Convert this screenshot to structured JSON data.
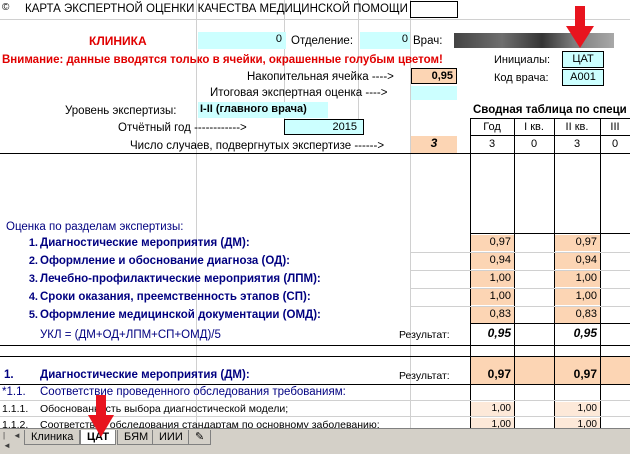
{
  "header": {
    "icon_label": "©",
    "title": "КАРТА ЭКСПЕРТНОЙ ОЦЕНКИ КАЧЕСТВА МЕДИЦИНСКОЙ ПОМОЩИ",
    "clinic_label": "КЛИНИКА",
    "clinic_value": "0",
    "department_label": "Отделение:",
    "department_value": "0",
    "doctor_label": "Врач:"
  },
  "warning": "Внимание: данные вводятся только в ячейки, окрашенные голубым цветом!",
  "initials": {
    "label": "Инициалы:",
    "value": "ЦАТ"
  },
  "doctor_code": {
    "label": "Код врача:",
    "value": "А001"
  },
  "accumulating_cell": {
    "label": "Накопительная ячейка ---->",
    "value": "0,95"
  },
  "final_score": {
    "label": "Итоговая экспертная оценка ---->",
    "value": ""
  },
  "expertise_level": {
    "label": "Уровень экспертизы:",
    "value": "I-II (главного врача)"
  },
  "report_year": {
    "label": "Отчётный год ------------>",
    "value": "2015"
  },
  "cases": {
    "label": "Число случаев, подвергнутых экспертизе ------>",
    "value": "3"
  },
  "summary_table": {
    "title": "Сводная таблица по специ",
    "columns": [
      "Год",
      "I кв.",
      "II кв.",
      "III"
    ],
    "counts": [
      "3",
      "0",
      "3",
      "0"
    ]
  },
  "sections_title": "Оценка по разделам экспертизы:",
  "sections": [
    {
      "num": "1.",
      "label": "Диагностические мероприятия (ДМ):",
      "year": "0,97",
      "q2": "0,97"
    },
    {
      "num": "2.",
      "label": "Оформление и обоснование диагноза (ОД):",
      "year": "0,94",
      "q2": "0,94"
    },
    {
      "num": "3.",
      "label": "Лечебно-профилактические мероприятия (ЛПМ):",
      "year": "1,00",
      "q2": "1,00"
    },
    {
      "num": "4.",
      "label": "Сроки оказания, преемственность этапов (СП):",
      "year": "1,00",
      "q2": "1,00"
    },
    {
      "num": "5.",
      "label": "Оформление медицинской документации (ОМД):",
      "year": "0,83",
      "q2": "0,83"
    }
  ],
  "ukl": {
    "formula": "УКЛ = (ДМ+ОД+ЛПМ+СП+ОМД)/5",
    "result_label": "Результат:",
    "year": "0,95",
    "q2": "0,95"
  },
  "detail": {
    "num": "1.",
    "label": "Диагностические мероприятия (ДМ):",
    "result_label": "Результат:",
    "year": "0,97",
    "q2": "0,97",
    "rows": [
      {
        "num": "*1.1.",
        "label": "Соответствие проведенного обследования требованиям:",
        "year": "",
        "q2": ""
      },
      {
        "num": "1.1.1.",
        "label": "Обоснованность выбора диагностической модели;",
        "year": "1,00",
        "q2": "1,00"
      },
      {
        "num": "1.1.2.",
        "label": "Соответствие обследования стандартам по основному заболеванию;",
        "year": "1,00",
        "q2": "1,00"
      }
    ]
  },
  "sheet_tabs": [
    "Клиника",
    "ЦАТ",
    "БЯМ",
    "ИИИ"
  ],
  "active_tab": "ЦАТ",
  "colors": {
    "input_blue": "#ccffff",
    "result_orange": "#fcd5b4",
    "warning_red": "#e00000",
    "arrow_red": "#e8141e"
  }
}
